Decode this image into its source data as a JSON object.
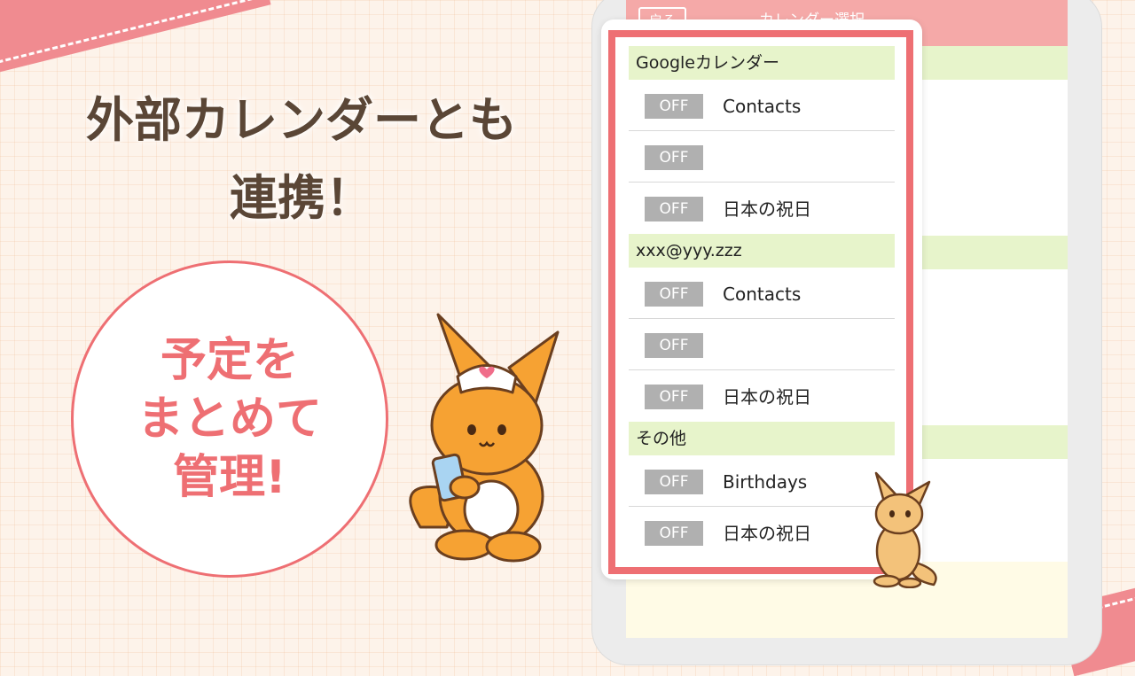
{
  "promo": {
    "headline_line1": "外部カレンダーとも",
    "headline_line2": "連携！",
    "circle_line1": "予定を",
    "circle_line2": "まとめて",
    "circle_line3": "管理!"
  },
  "app": {
    "back_label": "戻る",
    "title": "カレンダー選択"
  },
  "calendar_list": {
    "sections": [
      {
        "title": "Googleカレンダー",
        "items": [
          {
            "toggle": "OFF",
            "label": "Contacts"
          },
          {
            "toggle": "OFF",
            "label": ""
          },
          {
            "toggle": "OFF",
            "label": "日本の祝日"
          }
        ]
      },
      {
        "title": "xxx@yyy.zzz",
        "items": [
          {
            "toggle": "OFF",
            "label": "Contacts"
          },
          {
            "toggle": "OFF",
            "label": ""
          },
          {
            "toggle": "OFF",
            "label": "日本の祝日"
          }
        ]
      },
      {
        "title": "その他",
        "items": [
          {
            "toggle": "OFF",
            "label": "Birthdays"
          },
          {
            "toggle": "OFF",
            "label": "日本の祝日"
          }
        ]
      }
    ]
  },
  "colors": {
    "accent": "#ee6f73",
    "header": "#f5a9a8",
    "section_band": "#e7f4cb",
    "toggle_off": "#b0b0b0",
    "text_brown": "#5a4636"
  },
  "icons": {
    "mascot_large": "kangaroo-nurse-with-phone",
    "mascot_small": "small-kangaroo"
  }
}
